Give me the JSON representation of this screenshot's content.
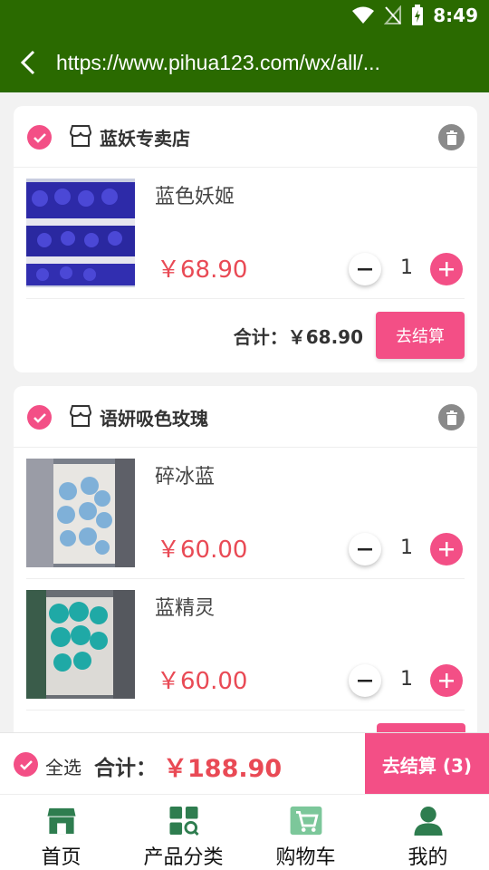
{
  "status_bar": {
    "time": "8:49"
  },
  "browser": {
    "url": "https://www.pihua123.com/wx/all/..."
  },
  "colors": {
    "accent": "#f34f86",
    "price": "#e94a55",
    "header": "#2a6a00",
    "tab_icon": "#2e7d4f"
  },
  "shops": [
    {
      "name": "蓝妖专卖店",
      "items": [
        {
          "name": "蓝色妖姬",
          "price": "￥68.90",
          "qty": "1"
        }
      ],
      "total_label": "合计：",
      "total": "￥68.90",
      "checkout_label": "去结算"
    },
    {
      "name": "语妍吸色玫瑰",
      "items": [
        {
          "name": "碎冰蓝",
          "price": "￥60.00",
          "qty": "1"
        },
        {
          "name": "蓝精灵",
          "price": "￥60.00",
          "qty": "1"
        }
      ]
    }
  ],
  "summary": {
    "select_all_label": "全选",
    "total_label": "合计：",
    "total": "￥188.90",
    "checkout_label": "去结算 (3)"
  },
  "tabbar": {
    "items": [
      {
        "label": "首页",
        "icon": "store-icon"
      },
      {
        "label": "产品分类",
        "icon": "category-icon"
      },
      {
        "label": "购物车",
        "icon": "cart-icon"
      },
      {
        "label": "我的",
        "icon": "user-icon"
      }
    ]
  }
}
